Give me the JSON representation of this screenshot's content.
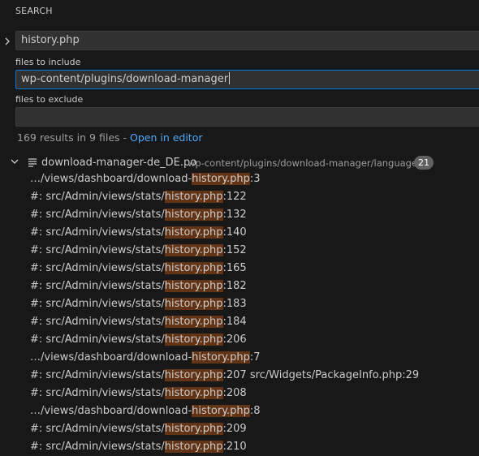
{
  "panel": {
    "title": "SEARCH"
  },
  "search": {
    "query": "history.php"
  },
  "include": {
    "label": "files to include",
    "value": "wp-content/plugins/download-manager"
  },
  "exclude": {
    "label": "files to exclude",
    "value": ""
  },
  "summary": {
    "text": "169 results in 9 files - ",
    "link": "Open in editor"
  },
  "file": {
    "name": "download-manager-de_DE.po",
    "path": "wp-content/plugins/download-manager/languages",
    "count": "21"
  },
  "matches": [
    {
      "pre": "…/views/dashboard/download-",
      "hl": "history.php",
      "post": ":3"
    },
    {
      "pre": "#: src/Admin/views/stats/",
      "hl": "history.php",
      "post": ":122"
    },
    {
      "pre": "#: src/Admin/views/stats/",
      "hl": "history.php",
      "post": ":132"
    },
    {
      "pre": "#: src/Admin/views/stats/",
      "hl": "history.php",
      "post": ":140"
    },
    {
      "pre": "#: src/Admin/views/stats/",
      "hl": "history.php",
      "post": ":152"
    },
    {
      "pre": "#: src/Admin/views/stats/",
      "hl": "history.php",
      "post": ":165"
    },
    {
      "pre": "#: src/Admin/views/stats/",
      "hl": "history.php",
      "post": ":182"
    },
    {
      "pre": "#: src/Admin/views/stats/",
      "hl": "history.php",
      "post": ":183"
    },
    {
      "pre": "#: src/Admin/views/stats/",
      "hl": "history.php",
      "post": ":184"
    },
    {
      "pre": "#: src/Admin/views/stats/",
      "hl": "history.php",
      "post": ":206"
    },
    {
      "pre": "…/views/dashboard/download-",
      "hl": "history.php",
      "post": ":7"
    },
    {
      "pre": "#: src/Admin/views/stats/",
      "hl": "history.php",
      "post": ":207 src/Widgets/PackageInfo.php:29"
    },
    {
      "pre": "#: src/Admin/views/stats/",
      "hl": "history.php",
      "post": ":208"
    },
    {
      "pre": "…/views/dashboard/download-",
      "hl": "history.php",
      "post": ":8"
    },
    {
      "pre": "#: src/Admin/views/stats/",
      "hl": "history.php",
      "post": ":209"
    },
    {
      "pre": "#: src/Admin/views/stats/",
      "hl": "history.php",
      "post": ":210"
    }
  ],
  "colors": {
    "highlight": "#623315",
    "focus": "#0078d4",
    "link": "#4daafc"
  }
}
